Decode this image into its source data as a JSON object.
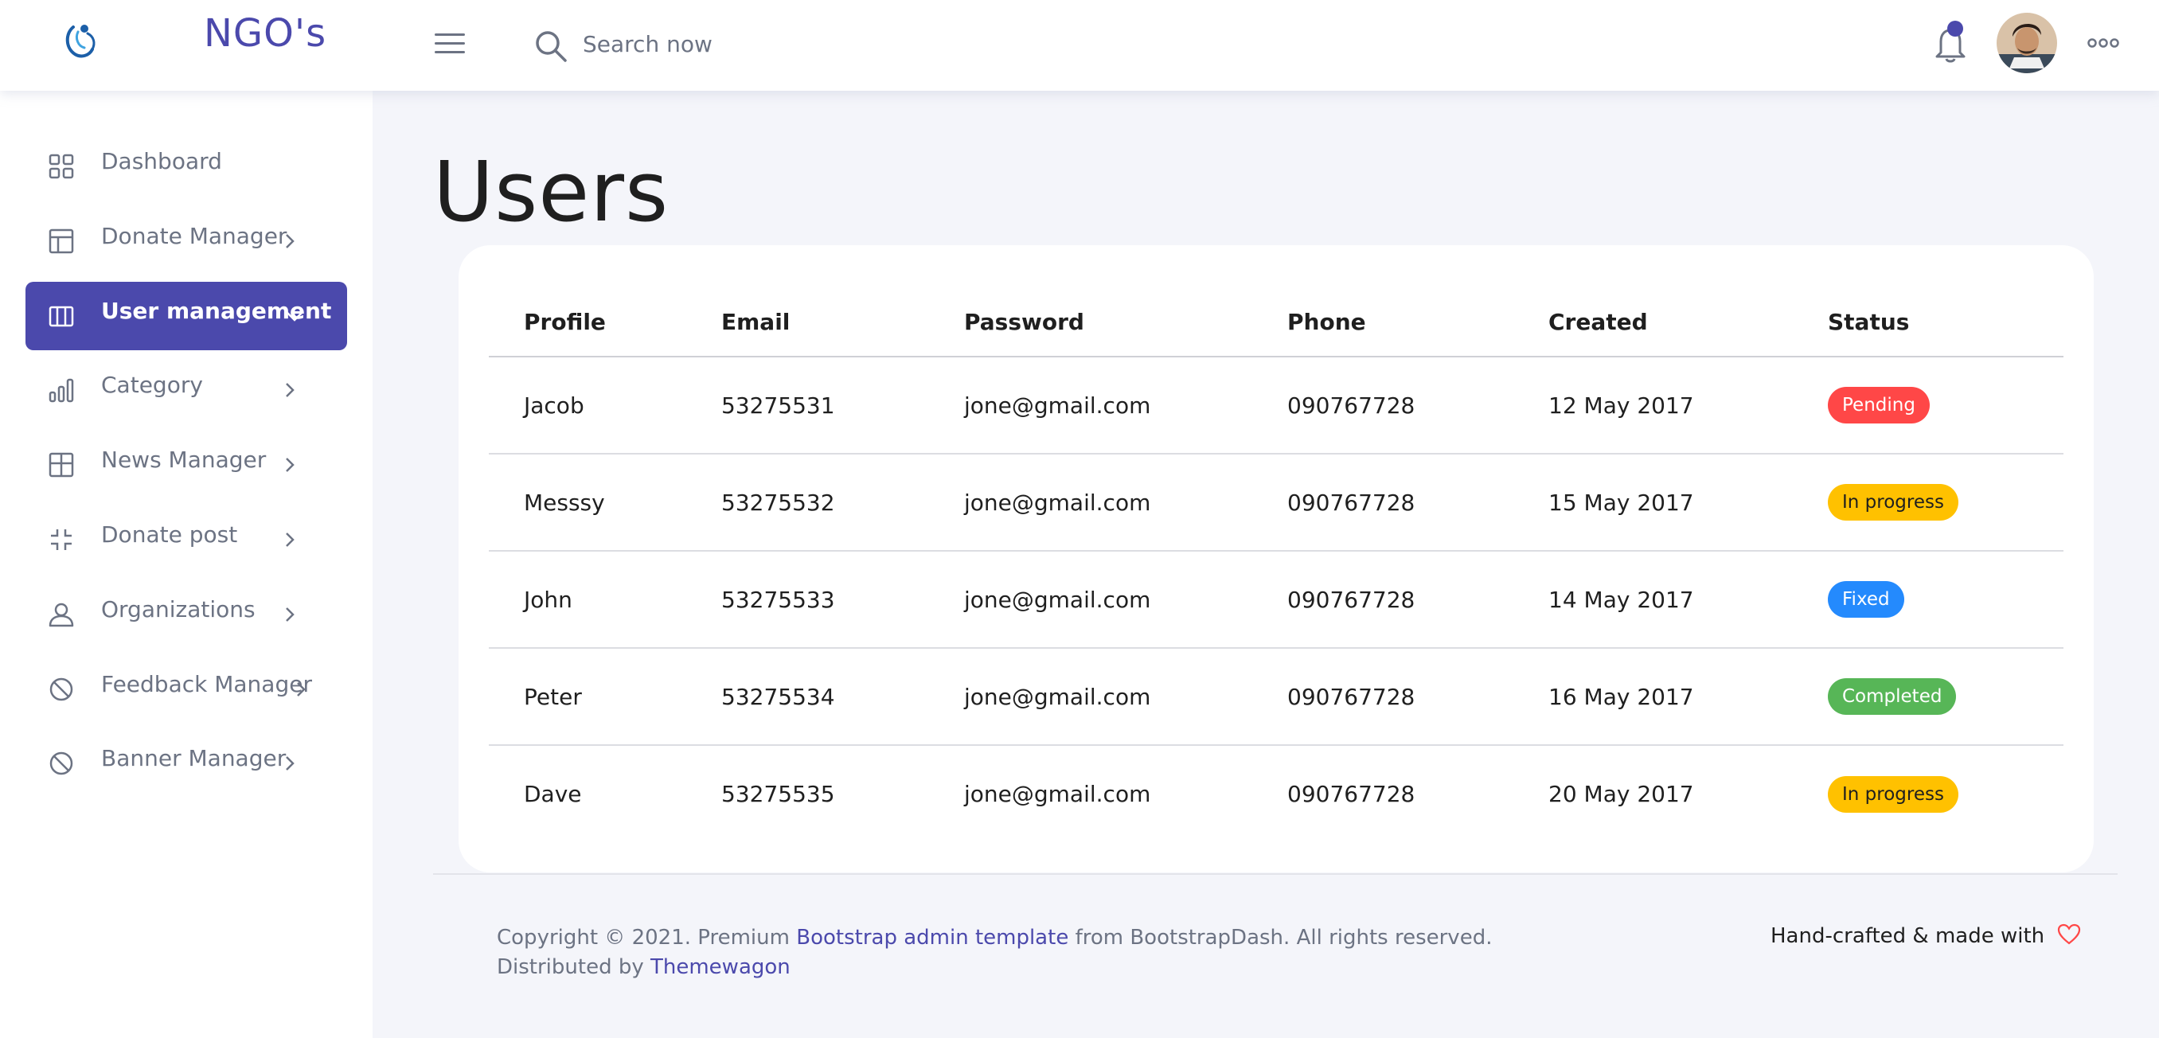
{
  "navbar": {
    "brand": "NGO's",
    "search_placeholder": "Search now",
    "icons": [
      "logo-icon",
      "menu-icon",
      "search-icon",
      "bell-icon",
      "avatar",
      "more-icon"
    ],
    "accent_color": "#4b49ac"
  },
  "sidebar": {
    "items": [
      {
        "label": "Dashboard",
        "icon": "grid-icon",
        "has_chevron": false
      },
      {
        "label": "Donate Manager",
        "icon": "layout-icon",
        "has_chevron": true
      },
      {
        "label": "User management",
        "icon": "columns-icon",
        "has_chevron": true,
        "active": true
      },
      {
        "label": "Category",
        "icon": "bar-chart-icon",
        "has_chevron": true
      },
      {
        "label": "News Manager",
        "icon": "table-icon",
        "has_chevron": true
      },
      {
        "label": "Donate post",
        "icon": "collapse-icon",
        "has_chevron": true
      },
      {
        "label": "Organizations",
        "icon": "user-icon",
        "has_chevron": true
      },
      {
        "label": "Feedback Manager",
        "icon": "ban-icon",
        "has_chevron": true
      },
      {
        "label": "Banner Manager",
        "icon": "ban-icon",
        "has_chevron": true
      }
    ]
  },
  "main": {
    "title": "Users",
    "table": {
      "headers": [
        "Profile",
        "Email",
        "Password",
        "Phone",
        "Created",
        "Status"
      ],
      "rows": [
        {
          "profile": "Jacob",
          "email": "53275531",
          "password": "jone@gmail.com",
          "phone": "090767728",
          "created": "12 May 2017",
          "status": "Pending"
        },
        {
          "profile": "Messsy",
          "email": "53275532",
          "password": "jone@gmail.com",
          "phone": "090767728",
          "created": "15 May 2017",
          "status": "In progress"
        },
        {
          "profile": "John",
          "email": "53275533",
          "password": "jone@gmail.com",
          "phone": "090767728",
          "created": "14 May 2017",
          "status": "Fixed"
        },
        {
          "profile": "Peter",
          "email": "53275534",
          "password": "jone@gmail.com",
          "phone": "090767728",
          "created": "16 May 2017",
          "status": "Completed"
        },
        {
          "profile": "Dave",
          "email": "53275535",
          "password": "jone@gmail.com",
          "phone": "090767728",
          "created": "20 May 2017",
          "status": "In progress"
        }
      ]
    },
    "status_colors": {
      "Pending": "#ff4747",
      "In progress": "#ffc100",
      "Fixed": "#248afd",
      "Completed": "#57b657"
    }
  },
  "footer": {
    "copyright_prefix": "Copyright © 2021. Premium",
    "link_template": "Bootstrap admin template",
    "copyright_suffix": "from BootstrapDash. All rights reserved.",
    "distributed_by": "Distributed by",
    "link_themewagon": "Themewagon",
    "crafted": "Hand-crafted & made with"
  }
}
